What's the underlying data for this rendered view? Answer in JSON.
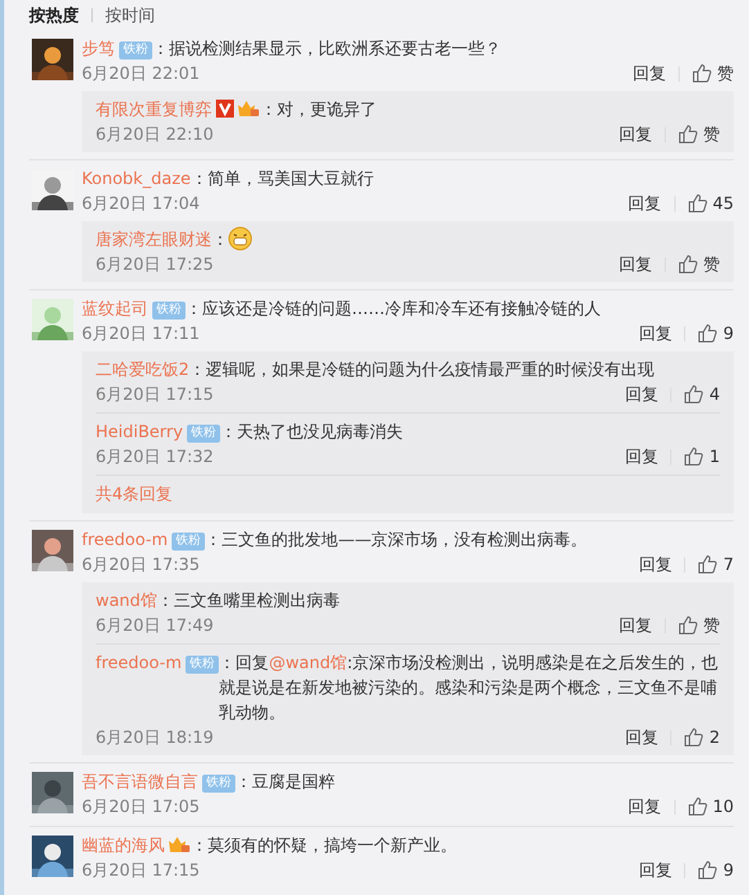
{
  "sort_tabs": [
    {
      "label": "按热度",
      "selected": true
    },
    {
      "label": "按时间",
      "selected": false
    }
  ],
  "comments": [
    {
      "user": "步笃",
      "badges": [
        {
          "kind": "fan",
          "text": "铁粉"
        }
      ],
      "content": "：据说检测结果显示，比欧洲系还要古老一些？",
      "time": "6月20日 22:01",
      "reply_label": "回复",
      "likes": "赞",
      "replies": [
        {
          "user": "有限次重复博弈",
          "badges": [
            {
              "kind": "verified"
            },
            {
              "kind": "crown"
            }
          ],
          "content": "：对，更诡异了",
          "time": "6月20日 22:10",
          "reply_label": "回复",
          "likes": "赞"
        }
      ]
    },
    {
      "user": "Konobk_daze",
      "content": "：简单，骂美国大豆就行",
      "time": "6月20日 17:04",
      "reply_label": "回复",
      "likes": "45",
      "replies": [
        {
          "user": "唐家湾左眼财迷",
          "content": "：",
          "emoji": true,
          "time": "6月20日 17:25",
          "reply_label": "回复",
          "likes": "赞"
        }
      ]
    },
    {
      "user": "蓝纹起司",
      "badges": [
        {
          "kind": "fan",
          "text": "铁粉"
        }
      ],
      "content": "：应该还是冷链的问题……冷库和冷车还有接触冷链的人",
      "time": "6月20日 17:11",
      "reply_label": "回复",
      "likes": "9",
      "replies": [
        {
          "user": "二哈爱吃饭2",
          "content": "：逻辑呢，如果是冷链的问题为什么疫情最严重的时候没有出现",
          "time": "6月20日 17:15",
          "reply_label": "回复",
          "likes": "4"
        },
        {
          "user": "HeidiBerry",
          "badges": [
            {
              "kind": "fan",
              "text": "铁粉"
            }
          ],
          "content": "：天热了也没见病毒消失",
          "time": "6月20日 17:32",
          "reply_label": "回复",
          "likes": "1"
        }
      ],
      "more_replies": "共4条回复"
    },
    {
      "user": "freedoo-m",
      "badges": [
        {
          "kind": "fan",
          "text": "铁粉"
        }
      ],
      "content": "：三文鱼的批发地——京深市场，没有检测出病毒。",
      "time": "6月20日 17:35",
      "reply_label": "回复",
      "likes": "7",
      "replies": [
        {
          "user": "wand馆",
          "content": "：三文鱼嘴里检测出病毒",
          "time": "6月20日 17:49",
          "reply_label": "回复",
          "likes": "赞"
        },
        {
          "user": "freedoo-m",
          "badges": [
            {
              "kind": "fan",
              "text": "铁粉"
            }
          ],
          "content_parts": [
            {
              "kind": "text",
              "text": "：回复"
            },
            {
              "kind": "mention",
              "text": "@wand馆"
            },
            {
              "kind": "text",
              "text": ":京深市场没检测出，说明感染是在之后发生的，也就是说是在新发地被污染的。感染和污染是两个概念，三文鱼不是哺乳动物。"
            }
          ],
          "time": "6月20日 18:19",
          "reply_label": "回复",
          "likes": "2"
        }
      ]
    },
    {
      "user": "吾不言语微自言",
      "badges": [
        {
          "kind": "fan",
          "text": "铁粉"
        }
      ],
      "content": "：豆腐是国粹",
      "time": "6月20日 17:05",
      "reply_label": "回复",
      "likes": "10"
    },
    {
      "user": "幽蓝的海风",
      "badges": [
        {
          "kind": "crown"
        }
      ],
      "content": "：莫须有的怀疑，搞垮一个新产业。",
      "time": "6月20日 17:15",
      "reply_label": "回复",
      "likes": "9"
    }
  ]
}
